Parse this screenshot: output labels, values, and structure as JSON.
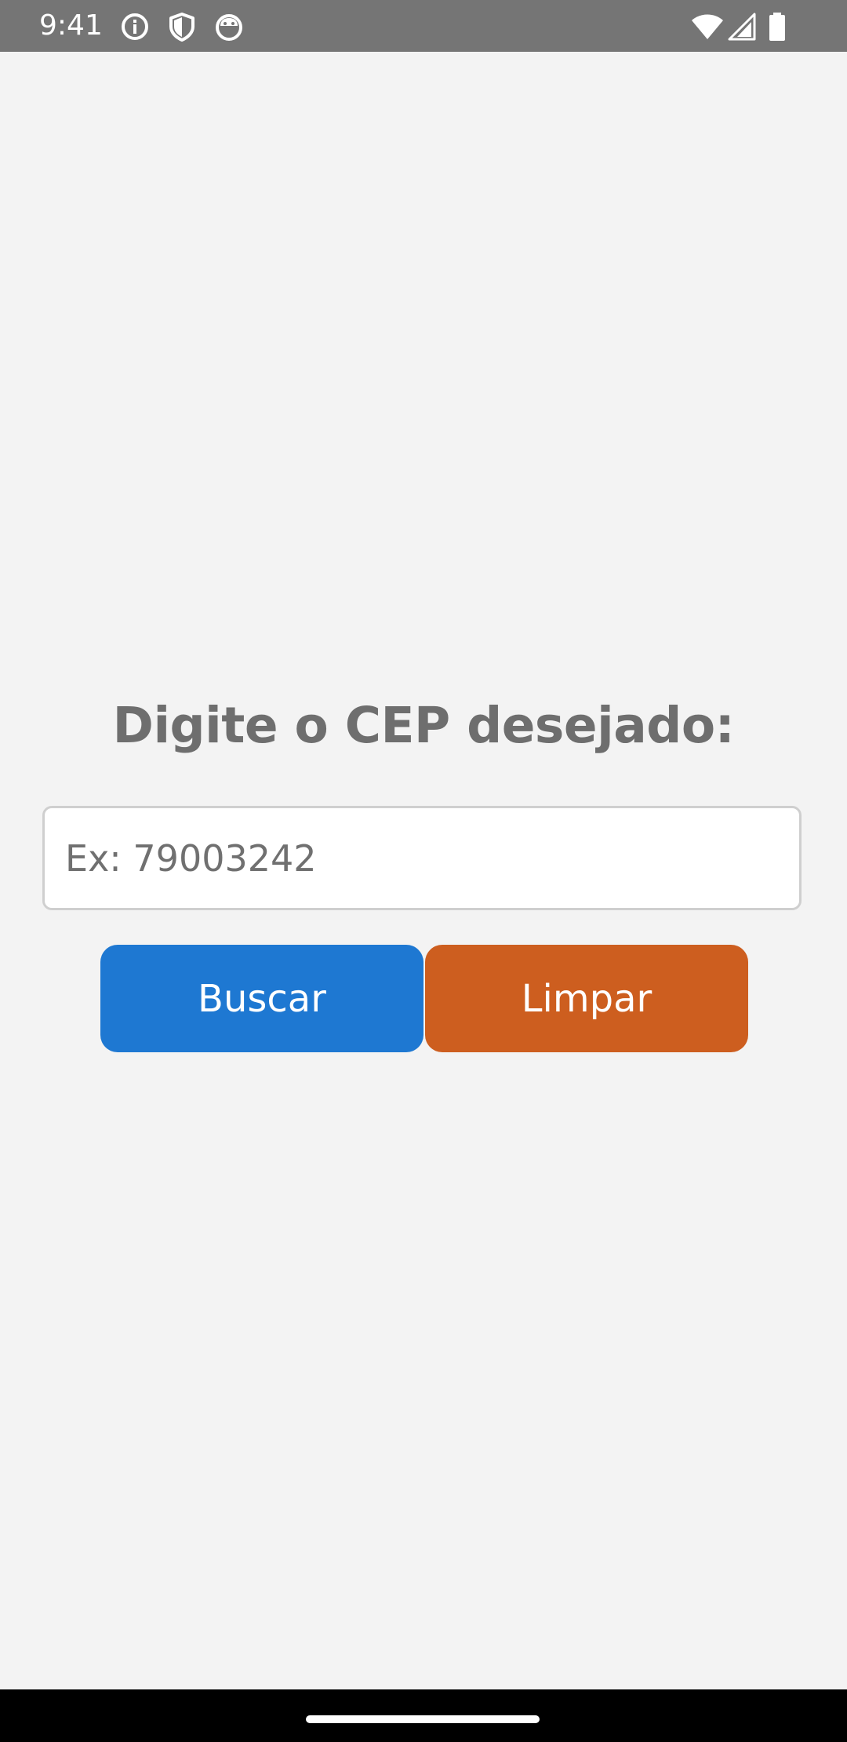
{
  "status_bar": {
    "time": "9:41",
    "icons_left": [
      "info-icon",
      "shield-icon",
      "android-debug-icon"
    ],
    "icons_right": [
      "wifi-icon",
      "signal-icon",
      "battery-icon"
    ],
    "background": "#757575"
  },
  "main": {
    "title": "Digite o CEP desejado:",
    "cep_input": {
      "value": "",
      "placeholder": "Ex: 79003242"
    },
    "buttons": {
      "search_label": "Buscar",
      "clear_label": "Limpar"
    }
  },
  "colors": {
    "background": "#f3f3f3",
    "title_text": "#6e6e6e",
    "search_button": "#1e78d2",
    "clear_button": "#cd5e1f"
  }
}
